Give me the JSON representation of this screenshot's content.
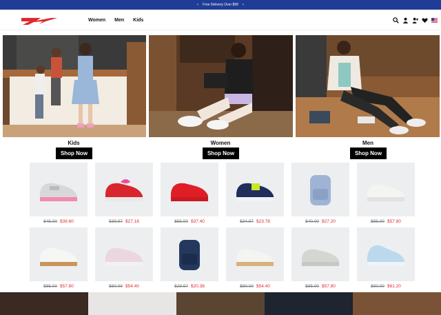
{
  "promo": {
    "text": "Free Delivery Over $99"
  },
  "nav": [
    "Women",
    "Men",
    "Kids"
  ],
  "icons": [
    "search-icon",
    "account-icon",
    "add-user-icon",
    "wishlist-heart-icon",
    "us-flag-icon"
  ],
  "categories": [
    {
      "label": "Kids",
      "button": "Shop Now"
    },
    {
      "label": "Women",
      "button": "Shop Now"
    },
    {
      "label": "Men",
      "button": "Shop Now"
    }
  ],
  "products_row1": [
    {
      "old": "$45.00",
      "new": "$39.60"
    },
    {
      "old": "$39.97",
      "new": "$27.18"
    },
    {
      "old": "$55.00",
      "new": "$37.40"
    },
    {
      "old": "$34.97",
      "new": "$23.78"
    },
    {
      "old": "$40.00",
      "new": "$27.20"
    },
    {
      "old": "$85.00",
      "new": "$57.80"
    }
  ],
  "products_row2": [
    {
      "old": "$85.00",
      "new": "$57.80"
    },
    {
      "old": "$80.00",
      "new": "$54.40"
    },
    {
      "old": "$29.97",
      "new": "$20.38"
    },
    {
      "old": "$80.00",
      "new": "$54.40"
    },
    {
      "old": "$85.00",
      "new": "$57.80"
    },
    {
      "old": "$90.00",
      "new": "$61.20"
    }
  ]
}
